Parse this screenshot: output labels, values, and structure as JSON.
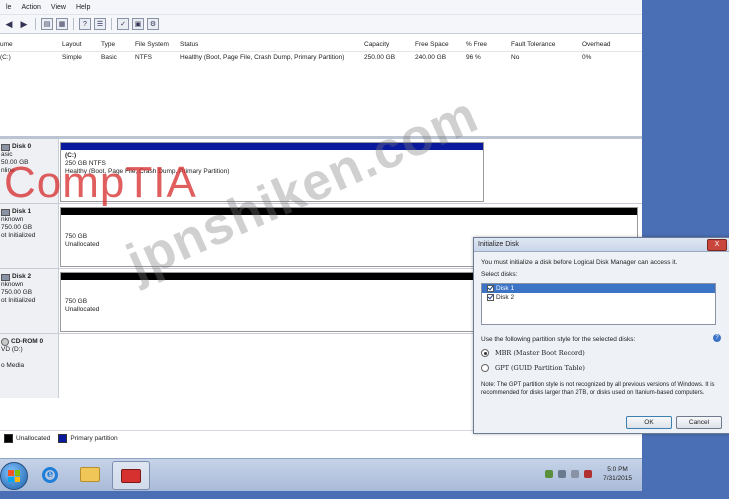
{
  "menu": {
    "file": "le",
    "action": "Action",
    "view": "View",
    "help": "Help"
  },
  "volume_table": {
    "headers": [
      "ume",
      "Layout",
      "Type",
      "File System",
      "Status",
      "Capacity",
      "Free Space",
      "% Free",
      "Fault Tolerance",
      "Overhead"
    ],
    "rows": [
      [
        "(C:)",
        "Simple",
        "Basic",
        "NTFS",
        "Healthy (Boot, Page File, Crash Dump, Primary Partition)",
        "250.00 GB",
        "240.00 GB",
        "96 %",
        "No",
        "0%"
      ]
    ]
  },
  "disks": [
    {
      "name": "Disk 0",
      "lines": [
        "asic",
        "50.00 GB",
        "nline"
      ],
      "partition": {
        "title": "(C:)",
        "size": "250 GB NTFS",
        "status": "Healthy (Boot, Page File, Crash Dump, Primary Partition)"
      }
    },
    {
      "name": "Disk 1",
      "lines": [
        "nknown",
        "750.00 GB",
        "ot Initialized"
      ],
      "partition": {
        "size": "750 GB",
        "status": "Unallocated"
      }
    },
    {
      "name": "Disk 2",
      "lines": [
        "nknown",
        "750.00 GB",
        "ot Initialized"
      ],
      "partition": {
        "size": "750 GB",
        "status": "Unallocated"
      }
    },
    {
      "name": "CD-ROM 0",
      "lines": [
        "VD (D:)",
        "",
        "o Media"
      ]
    }
  ],
  "legend": {
    "unallocated": "Unallocated",
    "primary": "Primary partition"
  },
  "dialog": {
    "title": "Initialize Disk",
    "close": "X",
    "intro": "You must initialize a disk before Logical Disk Manager can access it.",
    "select_label": "Select disks:",
    "disks": [
      "Disk 1",
      "Disk 2"
    ],
    "style_label": "Use the following partition style for the selected disks:",
    "mbr": "MBR (Master Boot Record)",
    "gpt": "GPT (GUID Partition Table)",
    "note": "Note: The GPT partition style is not recognized by all previous versions of Windows. It is recommended for disks larger than 2TB, or disks used on Itanium-based computers.",
    "help": "?",
    "ok": "OK",
    "cancel": "Cancel"
  },
  "taskbar": {
    "time": "5:0 PM",
    "date": "7/31/2015"
  },
  "watermarks": {
    "comptia": "CompTIA",
    "site": "jpnshiken.com"
  },
  "colors": {
    "primary_partition": "#0a1a9e",
    "unallocated": "#000000",
    "desktop": "#4a6fb5"
  }
}
